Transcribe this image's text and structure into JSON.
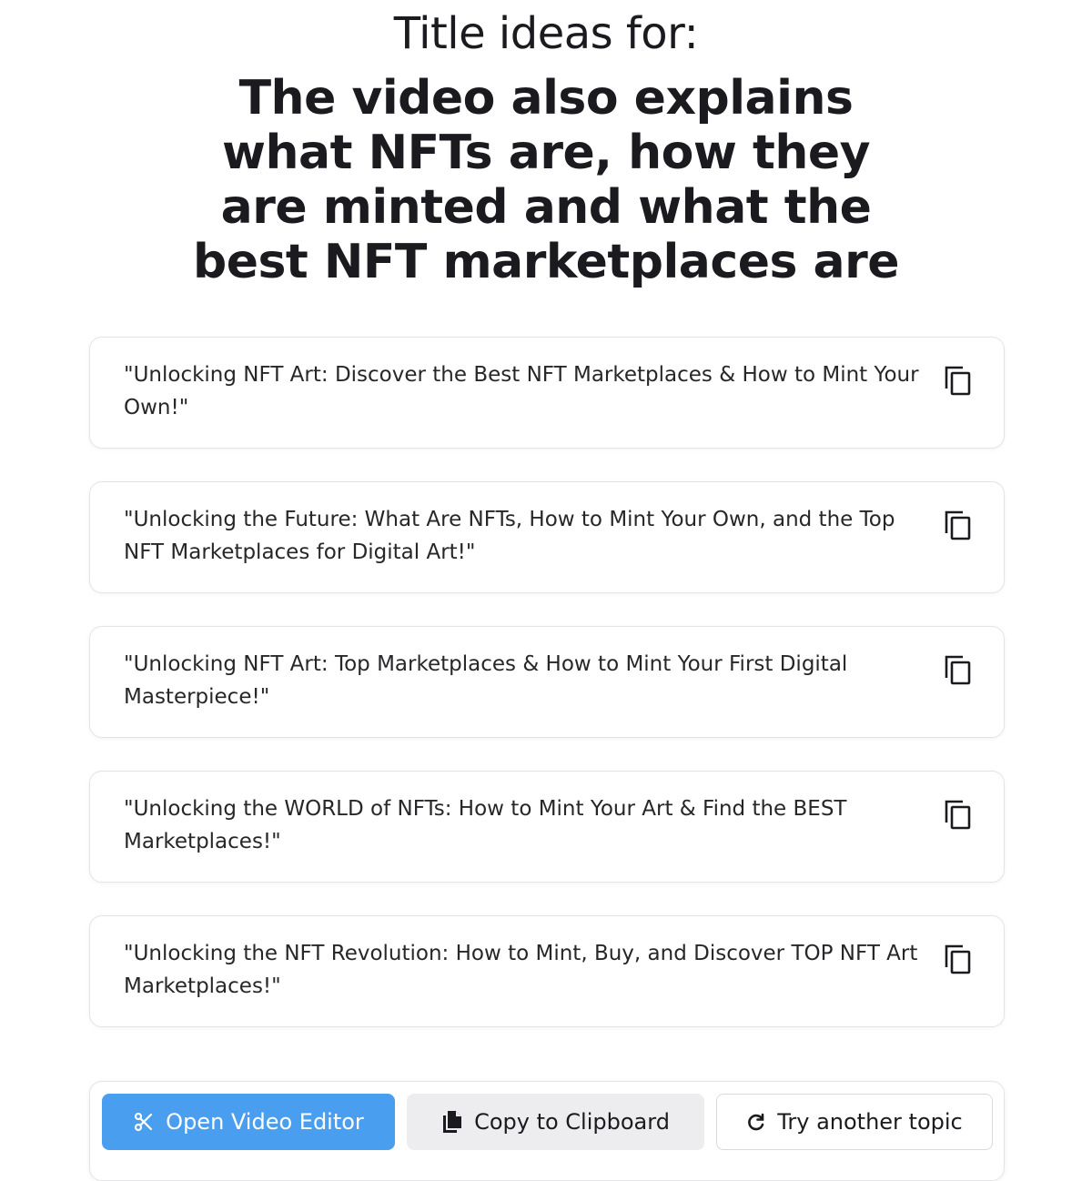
{
  "header": {
    "label": "Title ideas for:",
    "topic": "The video also explains what NFTs are, how they are minted and what the best NFT marketplaces are"
  },
  "ideas": [
    {
      "text": "\"Unlocking NFT Art: Discover the Best NFT Marketplaces & How to Mint Your Own!\"",
      "icon": "copy-icon"
    },
    {
      "text": "\"Unlocking the Future: What Are NFTs, How to Mint Your Own, and the Top NFT Marketplaces for Digital Art!\"",
      "icon": "copy-icon"
    },
    {
      "text": "\"Unlocking NFT Art: Top Marketplaces & How to Mint Your First Digital Masterpiece!\"",
      "icon": "copy-icon"
    },
    {
      "text": "\"Unlocking the WORLD of NFTs: How to Mint Your Art & Find the BEST Marketplaces!\"",
      "icon": "copy-icon"
    },
    {
      "text": "\"Unlocking the NFT Revolution: How to Mint, Buy, and Discover TOP NFT Art Marketplaces!\"",
      "icon": "copy-icon"
    }
  ],
  "actions": {
    "open_editor": {
      "label": "Open Video Editor",
      "icon": "scissors-icon"
    },
    "copy_clipboard": {
      "label": "Copy to Clipboard",
      "icon": "clipboard-icon"
    },
    "try_another": {
      "label": "Try another topic",
      "icon": "refresh-icon"
    }
  },
  "colors": {
    "primary": "#4a9ef0",
    "secondary_bg": "#ededef",
    "border": "#e4e4e7",
    "text": "#1b1b1f"
  }
}
